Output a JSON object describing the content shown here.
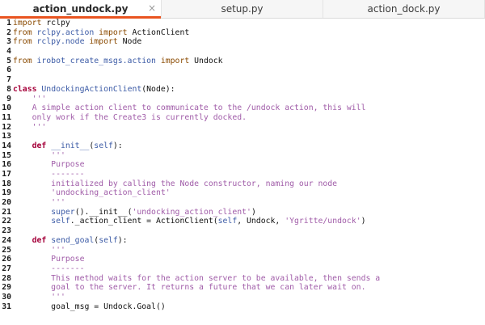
{
  "tabs": [
    {
      "label": "action_undock.py",
      "active": true
    },
    {
      "label": "setup.py",
      "active": false
    },
    {
      "label": "action_dock.py",
      "active": false
    }
  ],
  "close_glyph": "×",
  "colors": {
    "accent": "#e95420",
    "keyword": "#a5003a",
    "string": "#a05ca8",
    "name": "#3c5ba6",
    "import": "#8a4a00"
  },
  "lines": [
    {
      "n": "1",
      "tokens": [
        {
          "t": "import",
          "c": "imp"
        },
        {
          "t": " rclpy",
          "c": "plain"
        }
      ]
    },
    {
      "n": "2",
      "tokens": [
        {
          "t": "from",
          "c": "imp"
        },
        {
          "t": " rclpy.action ",
          "c": "mod"
        },
        {
          "t": "import",
          "c": "imp"
        },
        {
          "t": " ActionClient",
          "c": "plain"
        }
      ]
    },
    {
      "n": "3",
      "tokens": [
        {
          "t": "from",
          "c": "imp"
        },
        {
          "t": " rclpy.node ",
          "c": "mod"
        },
        {
          "t": "import",
          "c": "imp"
        },
        {
          "t": " Node",
          "c": "plain"
        }
      ]
    },
    {
      "n": "4",
      "tokens": []
    },
    {
      "n": "5",
      "tokens": [
        {
          "t": "from",
          "c": "imp"
        },
        {
          "t": " irobot_create_msgs.action ",
          "c": "mod"
        },
        {
          "t": "import",
          "c": "imp"
        },
        {
          "t": " Undock",
          "c": "plain"
        }
      ]
    },
    {
      "n": "6",
      "tokens": []
    },
    {
      "n": "7",
      "tokens": []
    },
    {
      "n": "8",
      "tokens": [
        {
          "t": "class",
          "c": "kw"
        },
        {
          "t": " UndockingActionClient",
          "c": "fn"
        },
        {
          "t": "(Node):",
          "c": "plain"
        }
      ]
    },
    {
      "n": "9",
      "tokens": [
        {
          "t": "    '''",
          "c": "str"
        }
      ]
    },
    {
      "n": "10",
      "tokens": [
        {
          "t": "    A simple action client to communicate to the /undock action, this will",
          "c": "str"
        }
      ]
    },
    {
      "n": "11",
      "tokens": [
        {
          "t": "    only work if the Create3 is currently docked.",
          "c": "str"
        }
      ]
    },
    {
      "n": "12",
      "tokens": [
        {
          "t": "    '''",
          "c": "str"
        }
      ]
    },
    {
      "n": "13",
      "tokens": []
    },
    {
      "n": "14",
      "tokens": [
        {
          "t": "    ",
          "c": "plain"
        },
        {
          "t": "def",
          "c": "kw"
        },
        {
          "t": " __init__",
          "c": "fn"
        },
        {
          "t": "(",
          "c": "plain"
        },
        {
          "t": "self",
          "c": "self"
        },
        {
          "t": "):",
          "c": "plain"
        }
      ]
    },
    {
      "n": "15",
      "tokens": [
        {
          "t": "        '''",
          "c": "str"
        }
      ]
    },
    {
      "n": "16",
      "tokens": [
        {
          "t": "        Purpose",
          "c": "str"
        }
      ]
    },
    {
      "n": "17",
      "tokens": [
        {
          "t": "        -------",
          "c": "str"
        }
      ]
    },
    {
      "n": "18",
      "tokens": [
        {
          "t": "        initialized by calling the Node constructor, naming our node",
          "c": "str"
        }
      ]
    },
    {
      "n": "19",
      "tokens": [
        {
          "t": "        'undocking_action_client'",
          "c": "str"
        }
      ]
    },
    {
      "n": "20",
      "tokens": [
        {
          "t": "        '''",
          "c": "str"
        }
      ]
    },
    {
      "n": "21",
      "tokens": [
        {
          "t": "        ",
          "c": "plain"
        },
        {
          "t": "super",
          "c": "fn"
        },
        {
          "t": "().__init__(",
          "c": "plain"
        },
        {
          "t": "'undocking_action_client'",
          "c": "str"
        },
        {
          "t": ")",
          "c": "plain"
        }
      ]
    },
    {
      "n": "22",
      "tokens": [
        {
          "t": "        ",
          "c": "plain"
        },
        {
          "t": "self",
          "c": "self"
        },
        {
          "t": "._action_client = ActionClient(",
          "c": "plain"
        },
        {
          "t": "self",
          "c": "self"
        },
        {
          "t": ", Undock, ",
          "c": "plain"
        },
        {
          "t": "'Ygritte/undock'",
          "c": "str"
        },
        {
          "t": ")",
          "c": "plain"
        }
      ]
    },
    {
      "n": "23",
      "tokens": []
    },
    {
      "n": "24",
      "tokens": [
        {
          "t": "    ",
          "c": "plain"
        },
        {
          "t": "def",
          "c": "kw"
        },
        {
          "t": " send_goal",
          "c": "fn"
        },
        {
          "t": "(",
          "c": "plain"
        },
        {
          "t": "self",
          "c": "self"
        },
        {
          "t": "):",
          "c": "plain"
        }
      ]
    },
    {
      "n": "25",
      "tokens": [
        {
          "t": "        '''",
          "c": "str"
        }
      ]
    },
    {
      "n": "26",
      "tokens": [
        {
          "t": "        Purpose",
          "c": "str"
        }
      ]
    },
    {
      "n": "27",
      "tokens": [
        {
          "t": "        -------",
          "c": "str"
        }
      ]
    },
    {
      "n": "28",
      "tokens": [
        {
          "t": "        This method waits for the action server to be available, then sends a",
          "c": "str"
        }
      ]
    },
    {
      "n": "29",
      "tokens": [
        {
          "t": "        goal to the server. It returns a future that we can later wait on.",
          "c": "str"
        }
      ]
    },
    {
      "n": "30",
      "tokens": [
        {
          "t": "        '''",
          "c": "str"
        }
      ]
    },
    {
      "n": "31",
      "tokens": [
        {
          "t": "        goal_msg = Undock.Goal()",
          "c": "plain"
        }
      ]
    }
  ]
}
